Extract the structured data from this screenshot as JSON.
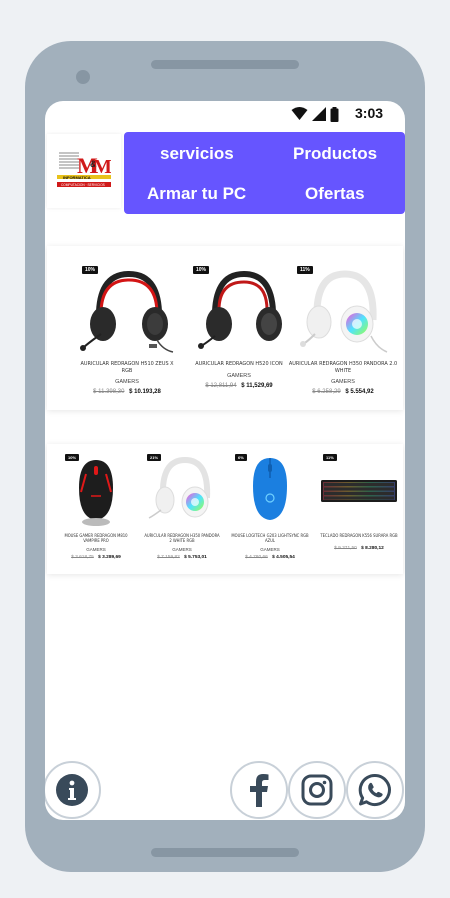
{
  "status": {
    "time": "3:03"
  },
  "logo": {
    "text": "M&M",
    "subtitle": "INFORMATICA"
  },
  "nav": {
    "servicios": "servicios",
    "productos": "Productos",
    "armar": "Armar tu PC",
    "ofertas": "Ofertas"
  },
  "products_row1": [
    {
      "badge": "10%",
      "name": "AURICULAR REDRAGON H510 ZEUS X RGB",
      "category": "GAMERS",
      "old_price": "$ 11.398,30",
      "new_price": "$ 10.193,28"
    },
    {
      "badge": "10%",
      "name": "AURICULAR REDRAGON H520 ICON",
      "category": "GAMERS",
      "old_price": "$ 12,811,94",
      "new_price": "$ 11,529,69"
    },
    {
      "badge": "11%",
      "name": "AURICULAR REDRAGON H350 PANDORA 2.0 WHITE",
      "category": "GAMERS",
      "old_price": "$ 6.258,29",
      "new_price": "$ 5.554,92"
    }
  ],
  "products_row2": [
    {
      "badge": "10%",
      "name": "MOUSE GAMER REDRAGON M810 VAMPIRE PRO",
      "category": "GAMERS",
      "old_price": "$ 3.618,75",
      "new_price": "$ 3.289,69"
    },
    {
      "badge": "21%",
      "name": "AURICULAR REDRAGON H350 PANDORA 2 WHITE RGB",
      "category": "GAMERS",
      "old_price": "$ 7.159,82",
      "new_price": "$ 5.753,01"
    },
    {
      "badge": "6%",
      "name": "MOUSE LOGITECH G203 LIGHTSYNC RGB AZUL",
      "category": "GAMERS",
      "old_price": "$ 4.780,66",
      "new_price": "$ 4.505,54"
    },
    {
      "badge": "11%",
      "name": "TECLADO REDRAGON K556 SURARA RGB",
      "category": "GAMERS",
      "old_price": "$ 9.371,50",
      "new_price": "$ 8.280,12"
    }
  ],
  "fabs": {
    "info": "info-icon",
    "facebook": "facebook-icon",
    "instagram": "instagram-icon",
    "whatsapp": "whatsapp-icon"
  },
  "colors": {
    "nav_bg": "#6655ff",
    "device_frame": "#a2b0bc",
    "fab_icon": "#394a5a"
  }
}
